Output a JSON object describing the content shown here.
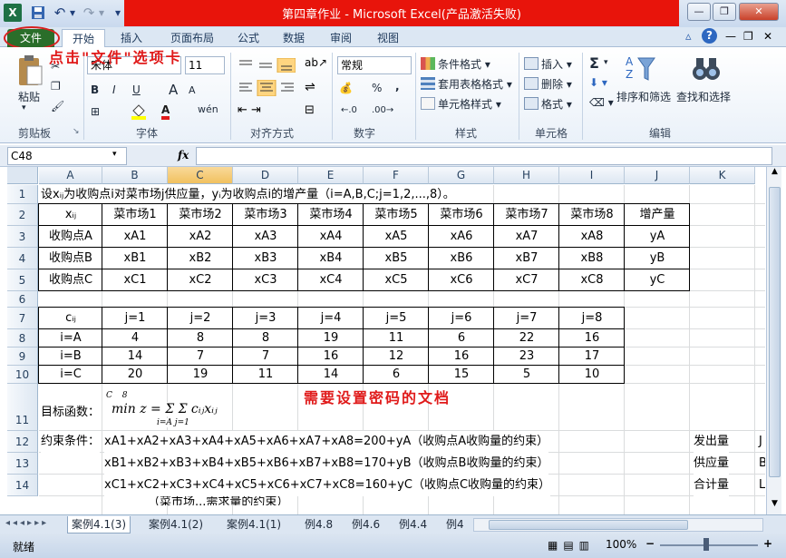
{
  "titlebar": {
    "title": "第四章作业 - Microsoft Excel(产品激活失败)",
    "excel_icon": "X",
    "save_icon": "💾",
    "undo": "↶",
    "redo": "↷",
    "qa_dropdown": "▾",
    "minimize": "—",
    "restore": "❐",
    "close": "✕"
  },
  "tabs": [
    "文件",
    "开始",
    "插入",
    "页面布局",
    "公式",
    "数据",
    "审阅",
    "视图"
  ],
  "annotation_file": "点击\"文件\"选项卡",
  "ribbon": {
    "paste": "粘贴",
    "clipboard_label": "剪贴板",
    "font_name": "宋体",
    "font_size": "11",
    "bold": "B",
    "italic": "I",
    "underline": "U",
    "grow_font": "A",
    "shrink_font": "A",
    "font_color": "A",
    "phonetic": "wén",
    "font_label": "字体",
    "align_label": "对齐方式",
    "number_format": "常规",
    "percent": "%",
    "comma": ",",
    "number_label": "数字",
    "cond_format": "条件格式",
    "table_format": "套用表格格式",
    "cell_style": "单元格样式",
    "style_label": "样式",
    "insert": "插入",
    "delete": "删除",
    "format": "格式",
    "cells_label": "单元格",
    "sigma": "Σ",
    "sort_filter": "排序和筛选",
    "find_select": "查找和选择",
    "edit_label": "编辑"
  },
  "formula_bar": {
    "name_box": "C48",
    "fx": "fx",
    "value": ""
  },
  "columns": [
    "A",
    "B",
    "C",
    "D",
    "E",
    "F",
    "G",
    "H",
    "I",
    "J",
    "K"
  ],
  "rows": [
    "1",
    "2",
    "3",
    "4",
    "5",
    "6",
    "7",
    "8",
    "9",
    "10",
    "11",
    "12",
    "13",
    "14"
  ],
  "sheet": {
    "r1": "设xᵢⱼ为收购点i对菜市场j供应量，yᵢ为收购点i的增产量（i=A,B,C;j=1,2,...,8）。",
    "r2": [
      "xᵢⱼ",
      "菜市场1",
      "菜市场2",
      "菜市场3",
      "菜市场4",
      "菜市场5",
      "菜市场6",
      "菜市场7",
      "菜市场8",
      "增产量"
    ],
    "r3": [
      "收购点A",
      "xA1",
      "xA2",
      "xA3",
      "xA4",
      "xA5",
      "xA6",
      "xA7",
      "xA8",
      "yA"
    ],
    "r4": [
      "收购点B",
      "xB1",
      "xB2",
      "xB3",
      "xB4",
      "xB5",
      "xB6",
      "xB7",
      "xB8",
      "yB"
    ],
    "r5": [
      "收购点C",
      "xC1",
      "xC2",
      "xC3",
      "xC4",
      "xC5",
      "xC6",
      "xC7",
      "xC8",
      "yC"
    ],
    "r7": [
      "cᵢⱼ",
      "j=1",
      "j=2",
      "j=3",
      "j=4",
      "j=5",
      "j=6",
      "j=7",
      "j=8"
    ],
    "r8": [
      "i=A",
      "4",
      "8",
      "8",
      "19",
      "11",
      "6",
      "22",
      "16"
    ],
    "r9": [
      "i=B",
      "14",
      "7",
      "7",
      "16",
      "12",
      "16",
      "23",
      "17"
    ],
    "r10": [
      "i=C",
      "20",
      "19",
      "11",
      "14",
      "6",
      "15",
      "5",
      "10"
    ],
    "objective_label": "目标函数：",
    "objective_formula": "min z = Σ Σ cᵢⱼxᵢⱼ",
    "objective_sum_lower": "i=A  j=1",
    "objective_sum_upper": "C    8",
    "annotation_doc": "需要设置密码的文档",
    "r12_label": "约束条件：",
    "r12": "xA1+xA2+xA3+xA4+xA5+xA6+xA7+xA8=200+yA（收购点A收购量的约束）",
    "r13": "xB1+xB2+xB3+xB4+xB5+xB6+xB7+xB8=170+yB（收购点B收购量的约束）",
    "r14": "xC1+xC2+xC3+xC4+xC5+xC6+xC7+xC8=160+yC（收购点C收购量的约束）",
    "r15_partial": "（菜市场...需求量的约束）",
    "k12": "发出量",
    "k13": "供应量",
    "k14": "合计量",
    "l12": "J",
    "l13": "B",
    "l14": "L"
  },
  "sheet_tabs": [
    "案例4.1(3)",
    "案例4.1(2)",
    "案例4.1(1)",
    "例4.8",
    "例4.6",
    "例4.4",
    "例4"
  ],
  "status": {
    "ready": "就绪",
    "zoom": "100%",
    "zoom_out": "−",
    "zoom_in": "+"
  },
  "colors": {
    "title_red": "#e8140b",
    "file_tab": "#2a6e2a",
    "annotation": "#e01a1a"
  }
}
